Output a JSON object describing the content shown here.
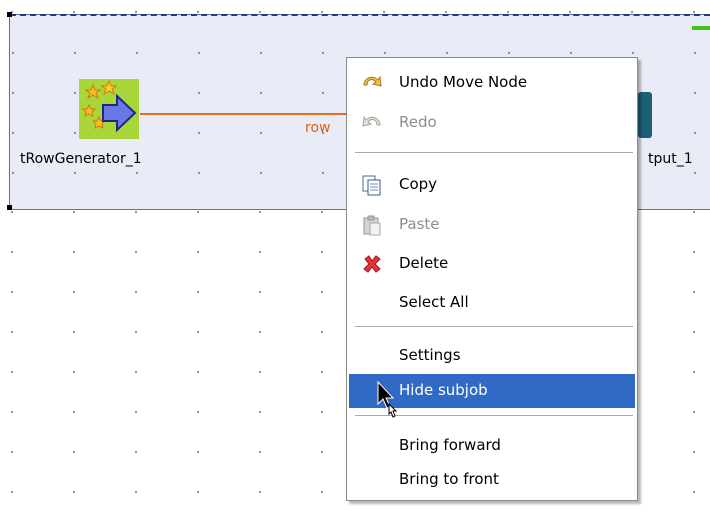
{
  "canvas": {
    "components": [
      {
        "label": "tRowGenerator_1",
        "icon": "row-generator-icon"
      },
      {
        "label": "tput_1",
        "icon": "log-output-icon"
      }
    ],
    "connection": {
      "label": "row"
    }
  },
  "context_menu": {
    "items": [
      {
        "label": "Undo Move Node",
        "icon": "undo-icon",
        "enabled": true
      },
      {
        "label": "Redo",
        "icon": "redo-icon",
        "enabled": false
      },
      {
        "label": "Copy",
        "icon": "copy-icon",
        "enabled": true
      },
      {
        "label": "Paste",
        "icon": "paste-icon",
        "enabled": false
      },
      {
        "label": "Delete",
        "icon": "delete-icon",
        "enabled": true
      },
      {
        "label": "Select All",
        "icon": "",
        "enabled": true
      },
      {
        "label": "Settings",
        "icon": "",
        "enabled": true
      },
      {
        "label": "Hide subjob",
        "icon": "",
        "enabled": true,
        "highlighted": true
      },
      {
        "label": "Bring forward",
        "icon": "",
        "enabled": true
      },
      {
        "label": "Bring to front",
        "icon": "",
        "enabled": true
      }
    ]
  },
  "colors": {
    "subjob_background": "#e9ebf6",
    "connection": "#e86a1e",
    "menu_highlight": "#316ac5"
  }
}
